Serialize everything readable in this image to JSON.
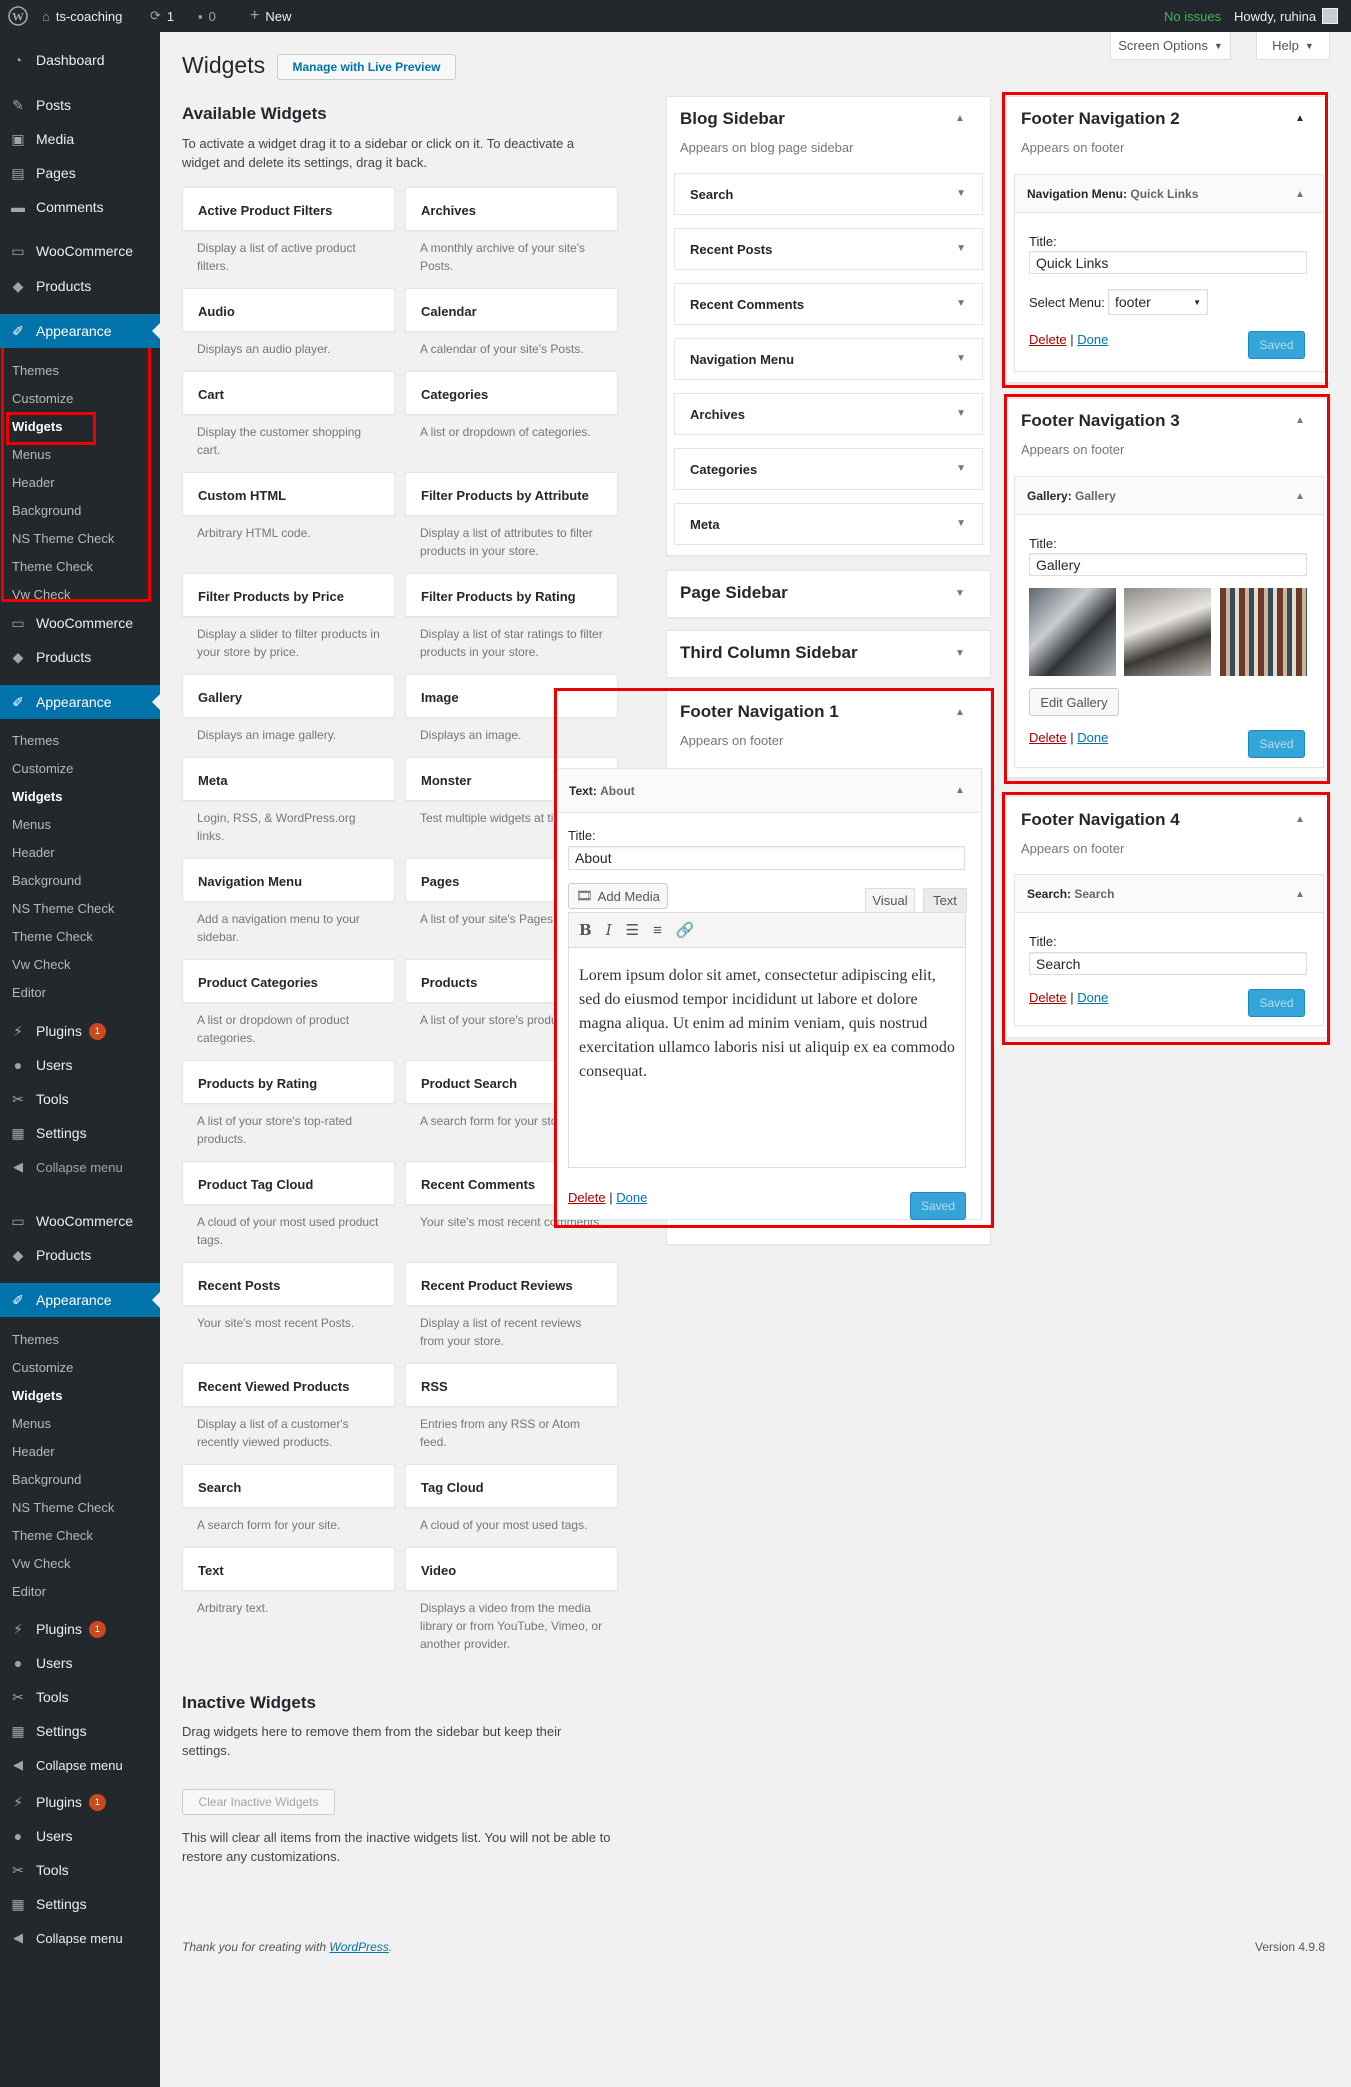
{
  "adminbar": {
    "site": "ts-coaching",
    "updates": "1",
    "comments": "0",
    "new": "New",
    "status": "No issues",
    "greeting": "Howdy, ruhina"
  },
  "page": {
    "title": "Widgets",
    "live_preview": "Manage with Live Preview",
    "screen_options": "Screen Options",
    "help": "Help"
  },
  "sidebar": {
    "top": [
      {
        "label": "Dashboard",
        "icon": "dashboard-icon"
      },
      {
        "label": "Posts",
        "icon": "pin-icon"
      },
      {
        "label": "Media",
        "icon": "media-icon"
      },
      {
        "label": "Pages",
        "icon": "page-icon"
      },
      {
        "label": "Comments",
        "icon": "comment-icon"
      }
    ],
    "woocommerce": "WooCommerce",
    "products": "Products",
    "appearance": "Appearance",
    "appearance_sub_1": [
      "Themes",
      "Customize",
      "Widgets",
      "Menus",
      "Header",
      "Background",
      "NS Theme Check",
      "Theme Check",
      "Vw Check"
    ],
    "appearance_sub": [
      "Themes",
      "Customize",
      "Widgets",
      "Menus",
      "Header",
      "Background",
      "NS Theme Check",
      "Theme Check",
      "Vw Check",
      "Editor"
    ],
    "plugins": "Plugins",
    "plugins_badge": "1",
    "users": "Users",
    "tools": "Tools",
    "settings": "Settings",
    "collapse": "Collapse menu"
  },
  "available": {
    "title": "Available Widgets",
    "desc": "To activate a widget drag it to a sidebar or click on it. To deactivate a widget and delete its settings, drag it back.",
    "widgets": [
      [
        "Active Product Filters",
        "Display a list of active product filters.",
        "Archives",
        "A monthly archive of your site's Posts."
      ],
      [
        "Audio",
        "Displays an audio player.",
        "Calendar",
        "A calendar of your site's Posts."
      ],
      [
        "Cart",
        "Display the customer shopping cart.",
        "Categories",
        "A list or dropdown of categories."
      ],
      [
        "Custom HTML",
        "Arbitrary HTML code.",
        "Filter Products by Attribute",
        "Display a list of attributes to filter products in your store."
      ],
      [
        "Filter Products by Price",
        "Display a slider to filter products in your store by price.",
        "Filter Products by Rating",
        "Display a list of star ratings to filter products in your store."
      ],
      [
        "Gallery",
        "Displays an image gallery.",
        "Image",
        "Displays an image."
      ],
      [
        "Meta",
        "Login, RSS, & WordPress.org links.",
        "Monster",
        "Test multiple widgets at time."
      ],
      [
        "Navigation Menu",
        "Add a navigation menu to your sidebar.",
        "Pages",
        "A list of your site's Pages."
      ],
      [
        "Product Categories",
        "A list or dropdown of product categories.",
        "Products",
        "A list of your store's products."
      ],
      [
        "Products by Rating",
        "A list of your store's top-rated products.",
        "Product Search",
        "A search form for your store."
      ],
      [
        "Product Tag Cloud",
        "A cloud of your most used product tags.",
        "Recent Comments",
        "Your site's most recent comments."
      ],
      [
        "Recent Posts",
        "Your site's most recent Posts.",
        "Recent Product Reviews",
        "Display a list of recent reviews from your store."
      ],
      [
        "Recent Viewed Products",
        "Display a list of a customer's recently viewed products.",
        "RSS",
        "Entries from any RSS or Atom feed."
      ],
      [
        "Search",
        "A search form for your site.",
        "Tag Cloud",
        "A cloud of your most used tags."
      ],
      [
        "Text",
        "Arbitrary text.",
        "Video",
        "Displays a video from the media library or from YouTube, Vimeo, or another provider."
      ]
    ]
  },
  "inactive": {
    "title": "Inactive Widgets",
    "desc": "Drag widgets here to remove them from the sidebar but keep their settings.",
    "clear": "Clear Inactive Widgets",
    "note": "This will clear all items from the inactive widgets list. You will not be able to restore any customizations."
  },
  "footer": {
    "thanks": "Thank you for creating with",
    "wp": "WordPress",
    "period": ".",
    "version": "Version 4.9.8"
  },
  "blog_sidebar": {
    "title": "Blog Sidebar",
    "desc": "Appears on blog page sidebar",
    "items": [
      "Search",
      "Recent Posts",
      "Recent Comments",
      "Navigation Menu",
      "Archives",
      "Categories",
      "Meta"
    ]
  },
  "page_sidebar": {
    "title": "Page Sidebar"
  },
  "third_sidebar": {
    "title": "Third Column Sidebar"
  },
  "fn1": {
    "title": "Footer Navigation 1",
    "desc": "Appears on footer",
    "widget_type": "Text:",
    "widget_name": "About",
    "title_label": "Title:",
    "title_value": "About",
    "add_media": "Add Media",
    "tab_visual": "Visual",
    "tab_text": "Text",
    "content": "Lorem ipsum dolor sit amet, consectetur adipiscing elit, sed do eiusmod tempor incididunt ut labore et dolore magna aliqua. Ut enim ad minim veniam, quis nostrud exercitation ullamco laboris nisi ut aliquip ex ea commodo consequat.",
    "delete": "Delete",
    "sep": "|",
    "done": "Done",
    "saved": "Saved"
  },
  "fn2": {
    "title": "Footer Navigation 2",
    "desc": "Appears on footer",
    "widget_type": "Navigation Menu:",
    "widget_name": "Quick Links",
    "title_label": "Title:",
    "title_value": "Quick Links",
    "select_label": "Select Menu:",
    "select_value": "footer",
    "delete": "Delete",
    "sep": "|",
    "done": "Done",
    "saved": "Saved"
  },
  "fn3": {
    "title": "Footer Navigation 3",
    "desc": "Appears on footer",
    "widget_type": "Gallery:",
    "widget_name": "Gallery",
    "title_label": "Title:",
    "title_value": "Gallery",
    "edit_gallery": "Edit Gallery",
    "delete": "Delete",
    "sep": "|",
    "done": "Done",
    "saved": "Saved"
  },
  "fn4": {
    "title": "Footer Navigation 4",
    "desc": "Appears on footer",
    "widget_type": "Search:",
    "widget_name": "Search",
    "title_label": "Title:",
    "title_value": "Search",
    "delete": "Delete",
    "sep": "|",
    "done": "Done",
    "saved": "Saved"
  }
}
